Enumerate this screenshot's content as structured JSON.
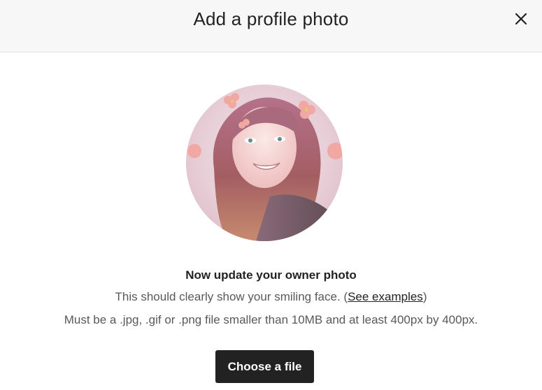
{
  "modal": {
    "title": "Add a profile photo",
    "close_icon": "close-icon"
  },
  "profile": {
    "photo_icon": "profile-photo-avatar"
  },
  "content": {
    "heading": "Now update your owner photo",
    "description_prefix": "This should clearly show your smiling face. (",
    "examples_link": "See examples",
    "description_suffix": ")",
    "requirements": "Must be a .jpg, .gif or .png file smaller than 10MB and at least 400px by 400px."
  },
  "actions": {
    "choose_file_label": "Choose a file"
  },
  "colors": {
    "header_bg": "#f7f7f7",
    "primary_button": "#222222",
    "secondary_text": "#595959"
  }
}
